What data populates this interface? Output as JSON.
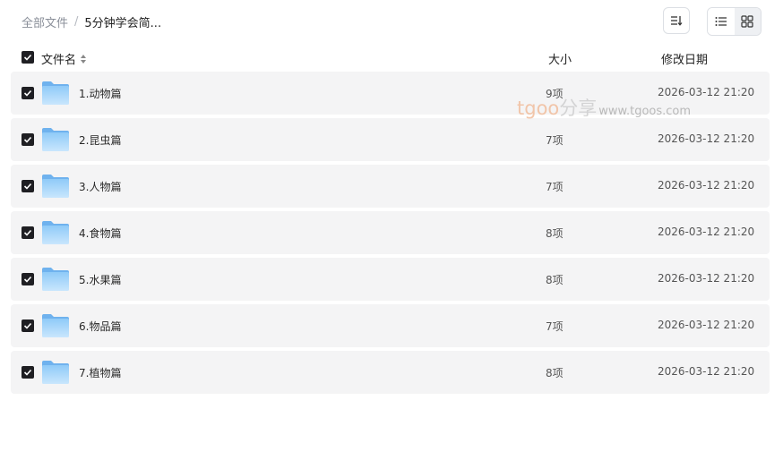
{
  "breadcrumb": {
    "root": "全部文件",
    "separator": "/",
    "current": "5分钟学会简..."
  },
  "toolbar": {
    "sort_icon": "sort-icon",
    "list_view_icon": "list-view-icon",
    "grid_view_icon": "grid-view-icon",
    "active_view": "list"
  },
  "columns": {
    "name": "文件名",
    "size": "大小",
    "date": "修改日期"
  },
  "watermark": {
    "brand": "tgoo",
    "text": "分享",
    "url": "www.tgoos.com"
  },
  "colors": {
    "row_bg": "#f4f4f5",
    "checkbox": "#1f1f23",
    "folder": "#7bbdf5"
  },
  "rows": [
    {
      "name": "1.动物篇",
      "size": "9项",
      "date": "2026-03-12 21:20",
      "checked": true
    },
    {
      "name": "2.昆虫篇",
      "size": "7项",
      "date": "2026-03-12 21:20",
      "checked": true
    },
    {
      "name": "3.人物篇",
      "size": "7项",
      "date": "2026-03-12 21:20",
      "checked": true
    },
    {
      "name": "4.食物篇",
      "size": "8项",
      "date": "2026-03-12 21:20",
      "checked": true
    },
    {
      "name": "5.水果篇",
      "size": "8项",
      "date": "2026-03-12 21:20",
      "checked": true
    },
    {
      "name": "6.物品篇",
      "size": "7项",
      "date": "2026-03-12 21:20",
      "checked": true
    },
    {
      "name": "7.植物篇",
      "size": "8项",
      "date": "2026-03-12 21:20",
      "checked": true
    }
  ]
}
